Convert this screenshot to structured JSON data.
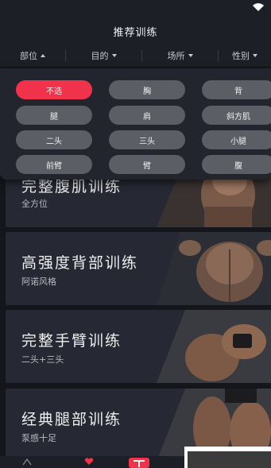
{
  "header": {
    "title": "推荐训练"
  },
  "filters": [
    {
      "label": "部位",
      "open": true
    },
    {
      "label": "目的",
      "open": false
    },
    {
      "label": "场所",
      "open": false
    },
    {
      "label": "性别",
      "open": false
    }
  ],
  "dropdown": {
    "options": [
      "不选",
      "胸",
      "背",
      "腿",
      "肩",
      "斜方肌",
      "二头",
      "三头",
      "小腿",
      "前臂",
      "臂",
      "腹"
    ],
    "selected": "不选"
  },
  "cards": [
    {
      "title": "完整腹肌训练",
      "subtitle": "全方位"
    },
    {
      "title": "高强度背部训练",
      "subtitle": "阿诺风格"
    },
    {
      "title": "完整手臂训练",
      "subtitle": "二头+三头"
    },
    {
      "title": "经典腿部训练",
      "subtitle": "泵感十足"
    }
  ],
  "colors": {
    "accent": "#f0334a",
    "background": "#15161c",
    "card": "#262933",
    "chip": "#5c5e66"
  },
  "icons": [
    "wifi-icon",
    "nav-home-icon",
    "nav-heart-icon",
    "nav-logo"
  ]
}
